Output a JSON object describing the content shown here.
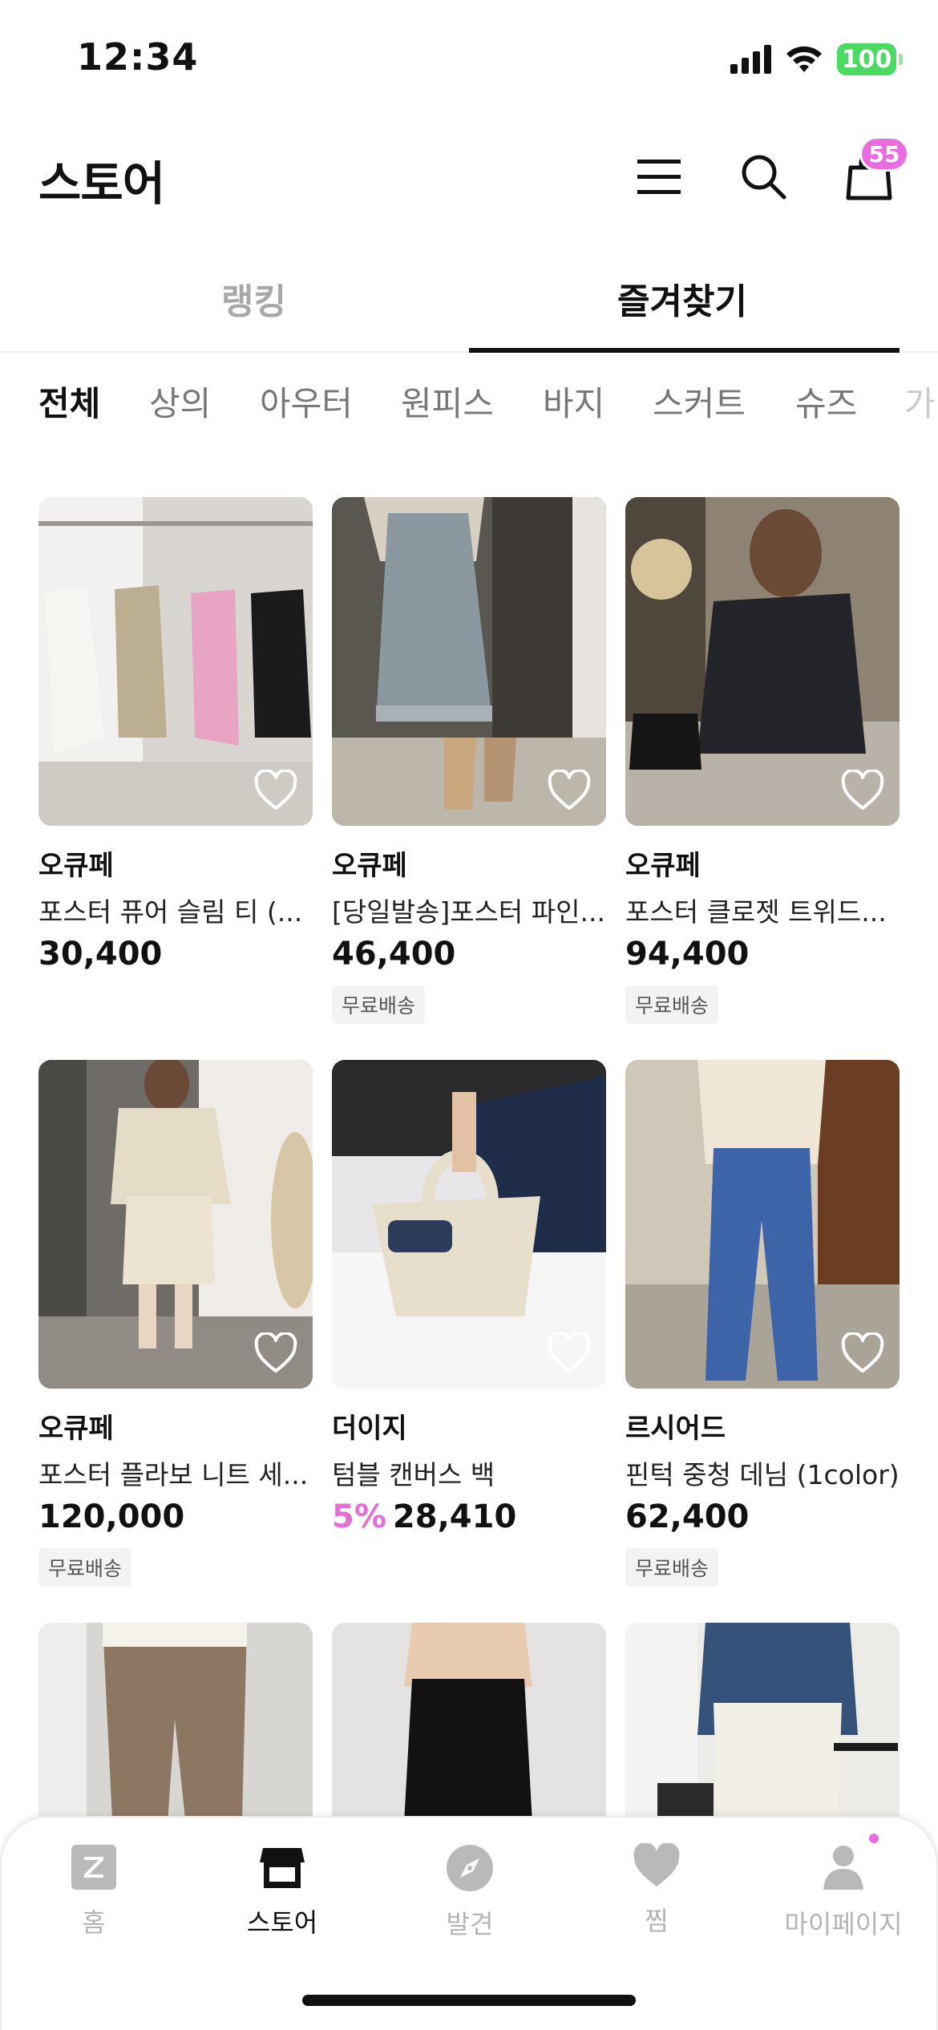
{
  "status": {
    "time": "12:34",
    "battery": "100"
  },
  "header": {
    "title": "스토어",
    "cart_count": "55"
  },
  "tabs": [
    {
      "label": "랭킹",
      "active": false
    },
    {
      "label": "즐겨찾기",
      "active": true
    }
  ],
  "categories": [
    "전체",
    "상의",
    "아우터",
    "원피스",
    "바지",
    "스커트",
    "슈즈",
    "가"
  ],
  "products": [
    {
      "brand": "오큐페",
      "name": "포스터 퓨어 슬림 티 (...",
      "price": "30,400",
      "discount": "",
      "shipping": ""
    },
    {
      "brand": "오큐페",
      "name": "[당일발송]포스터 파인...",
      "price": "46,400",
      "discount": "",
      "shipping": "무료배송"
    },
    {
      "brand": "오큐페",
      "name": "포스터 클로젯 트위드...",
      "price": "94,400",
      "discount": "",
      "shipping": "무료배송"
    },
    {
      "brand": "오큐페",
      "name": "포스터 플라보 니트 세...",
      "price": "120,000",
      "discount": "",
      "shipping": "무료배송"
    },
    {
      "brand": "더이지",
      "name": "텀블 캔버스 백",
      "price": "28,410",
      "discount": "5%",
      "shipping": ""
    },
    {
      "brand": "르시어드",
      "name": "핀턱 중청 데님 (1color)",
      "price": "62,400",
      "discount": "",
      "shipping": "무료배송"
    }
  ],
  "bottom_nav": [
    {
      "label": "홈",
      "icon": "z-logo-icon",
      "active": false
    },
    {
      "label": "스토어",
      "icon": "store-icon",
      "active": true
    },
    {
      "label": "발견",
      "icon": "compass-icon",
      "active": false
    },
    {
      "label": "찜",
      "icon": "heart-icon",
      "active": false
    },
    {
      "label": "마이페이지",
      "icon": "person-icon",
      "active": false
    }
  ],
  "colors": {
    "accent_pink": "#ea6ce1",
    "discount_pink": "#e36fd4",
    "battery_green": "#4cd964"
  }
}
